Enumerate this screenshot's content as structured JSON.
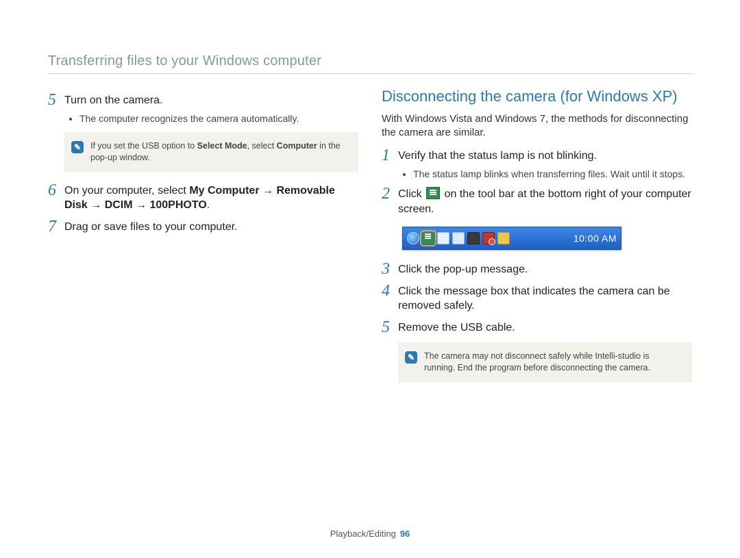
{
  "header": {
    "title": "Transferring files to your Windows computer"
  },
  "left": {
    "steps": {
      "s5": {
        "num": "5",
        "text": "Turn on the camera."
      },
      "s5_bullets": [
        "The computer recognizes the camera automatically."
      ],
      "note1": {
        "pre": "If you set the USB option to ",
        "b1": "Select Mode",
        "mid": ", select ",
        "b2": "Computer",
        "post": " in the pop-up window."
      },
      "s6": {
        "num": "6",
        "pre": "On your computer, select ",
        "b1": "My Computer",
        "arrow1": " → ",
        "b2": "Removable Disk",
        "arrow2": " → ",
        "b3": "DCIM",
        "arrow3": " → ",
        "b4": "100PHOTO",
        "post": "."
      },
      "s7": {
        "num": "7",
        "text": "Drag or save files to your computer."
      }
    }
  },
  "right": {
    "title": "Disconnecting the camera (for Windows XP)",
    "intro": "With Windows Vista and Windows 7, the methods for disconnecting the camera are similar.",
    "steps": {
      "s1": {
        "num": "1",
        "text": "Verify that the status lamp is not blinking."
      },
      "s1_bullets": [
        "The status lamp blinks when transferring files. Wait until it stops."
      ],
      "s2": {
        "num": "2",
        "pre": "Click ",
        "post": " on the tool bar at the bottom right of your computer screen."
      },
      "s3": {
        "num": "3",
        "text": "Click the pop-up message."
      },
      "s4": {
        "num": "4",
        "text": "Click the message box that indicates the camera can be removed safely."
      },
      "s5": {
        "num": "5",
        "text": "Remove the USB cable."
      }
    },
    "taskbar": {
      "clock": "10:00 AM"
    },
    "note2": "The camera may not disconnect safely while Intelli-studio is running. End the program before disconnecting the camera."
  },
  "footer": {
    "section": "Playback/Editing",
    "page": "96"
  }
}
